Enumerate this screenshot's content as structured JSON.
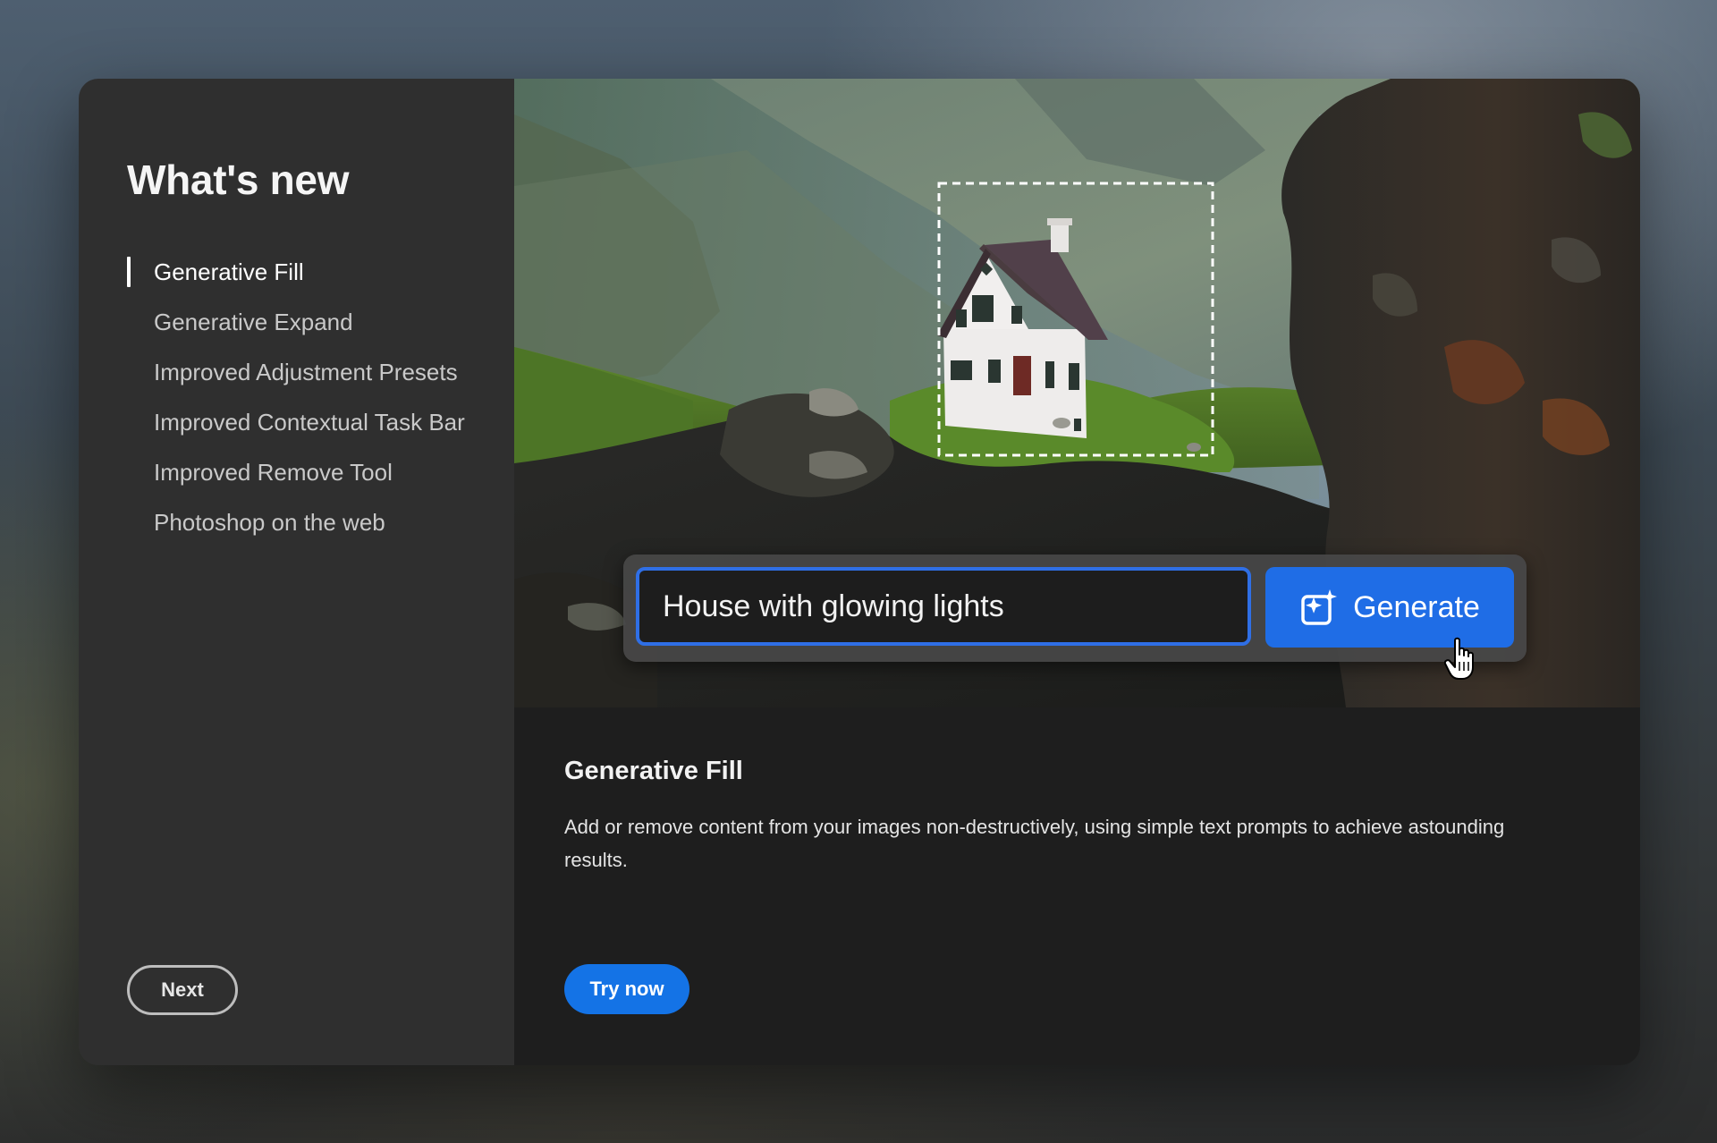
{
  "sidebar": {
    "title": "What's new",
    "items": [
      {
        "label": "Generative Fill",
        "active": true
      },
      {
        "label": "Generative Expand",
        "active": false
      },
      {
        "label": "Improved Adjustment Presets",
        "active": false
      },
      {
        "label": "Improved Contextual Task Bar",
        "active": false
      },
      {
        "label": "Improved Remove Tool",
        "active": false
      },
      {
        "label": "Photoshop on the web",
        "active": false
      }
    ],
    "next_label": "Next"
  },
  "hero": {
    "prompt_value": "House with glowing lights",
    "generate_label": "Generate",
    "generate_icon": "generative-fill-icon",
    "cursor_icon": "hand-pointer-icon"
  },
  "feature": {
    "title": "Generative Fill",
    "description": "Add or remove content from your images non-destructively, using simple text prompts to achieve astounding results.",
    "try_label": "Try now"
  },
  "colors": {
    "accent": "#1473e6",
    "sidebar_bg": "#2f2f2f",
    "content_bg": "#1e1e1e"
  }
}
